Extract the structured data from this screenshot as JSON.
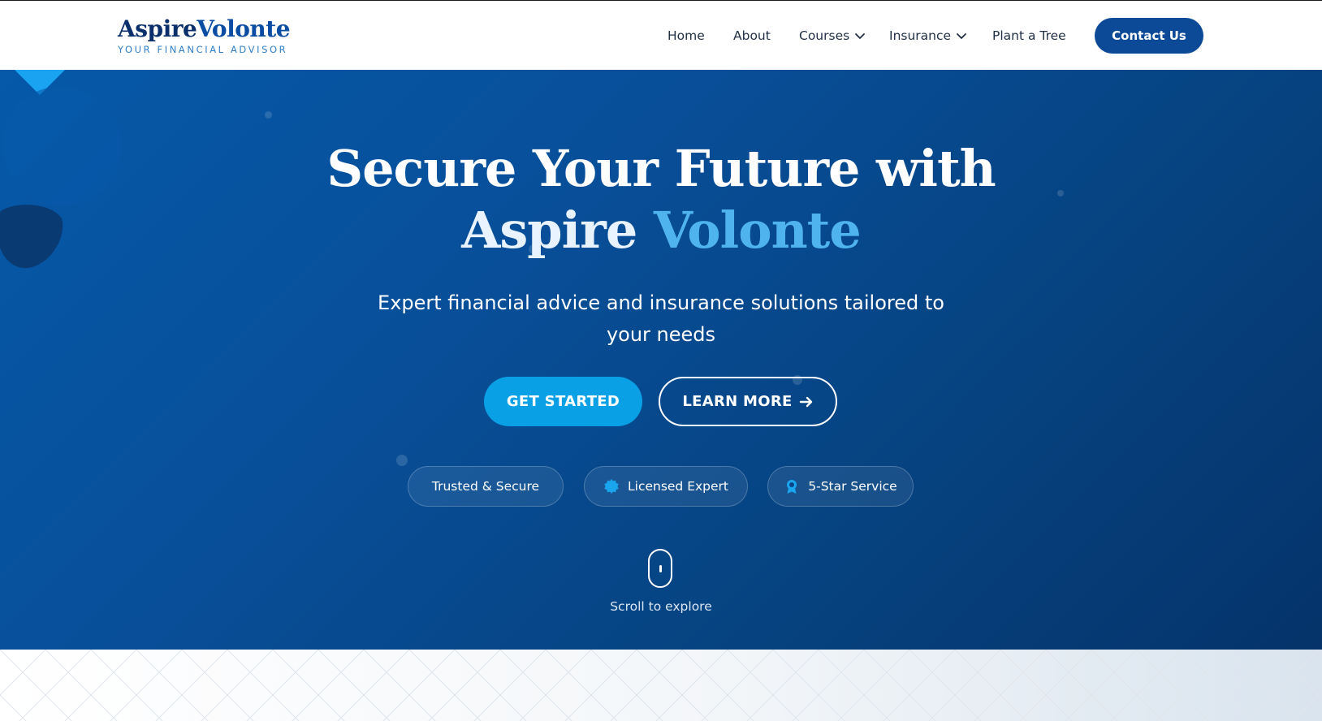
{
  "brand": {
    "name_part1": "Aspire",
    "name_part2": "Volonte",
    "tagline": "YOUR FINANCIAL ADVISOR"
  },
  "nav": {
    "items": [
      {
        "label": "Home"
      },
      {
        "label": "About"
      },
      {
        "label": "Courses",
        "icon": "chevron-down-icon"
      },
      {
        "label": "Insurance",
        "icon": "chevron-down-icon"
      },
      {
        "label": "Plant a Tree"
      }
    ],
    "contact_label": "Contact Us"
  },
  "hero": {
    "title_line1": "Secure Your Future with",
    "title_word1": "Aspire",
    "title_word2": "Volonte",
    "subtitle": "Expert financial advice and insurance solutions tailored to your needs",
    "primary_button": "GET STARTED",
    "secondary_button": "LEARN MORE",
    "badges": [
      {
        "label": "Trusted & Secure",
        "icon": "shield-icon"
      },
      {
        "label": "Licensed Expert",
        "icon": "certificate-icon"
      },
      {
        "label": "5-Star Service",
        "icon": "award-icon"
      }
    ],
    "scroll_text": "Scroll to explore"
  },
  "colors": {
    "brand_dark": "#0b2f6b",
    "brand_blue": "#0c4a98",
    "accent": "#0aa0e6",
    "highlight": "#4fb3ee",
    "hero_gradient_start": "#0559a8",
    "hero_gradient_end": "#05336a"
  }
}
